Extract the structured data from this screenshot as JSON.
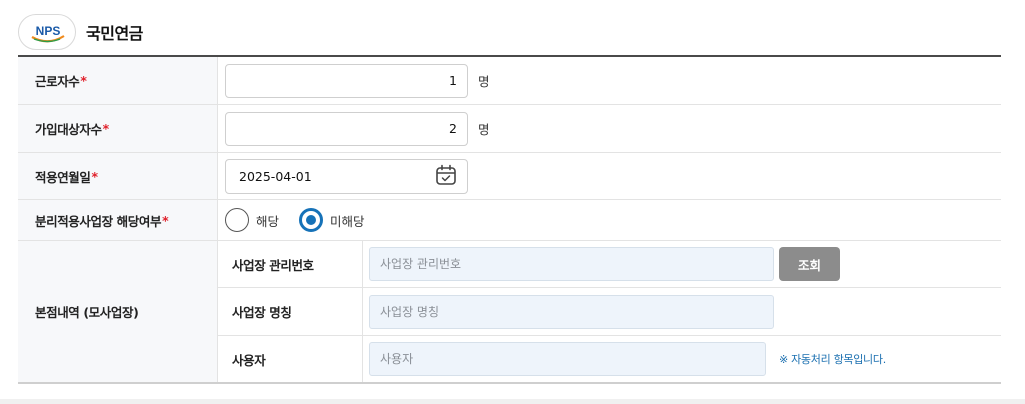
{
  "header": {
    "logo_text": "NPS",
    "title": "국민연금"
  },
  "form": {
    "workers": {
      "label": "근로자수",
      "required_mark": "*",
      "value": "1",
      "unit": "명"
    },
    "enrollees": {
      "label": "가입대상자수",
      "required_mark": "*",
      "value": "2",
      "unit": "명"
    },
    "apply_date": {
      "label": "적용연월일",
      "required_mark": "*",
      "value": "2025-04-01",
      "icon": "calendar-icon"
    },
    "separate_site": {
      "label": "분리적용사업장 해당여부",
      "required_mark": "*",
      "options": [
        {
          "label": "해당",
          "checked": false
        },
        {
          "label": "미해당",
          "checked": true
        }
      ]
    },
    "head_office": {
      "label": "본점내역 (모사업장)",
      "fields": {
        "mgmt_no": {
          "label": "사업장 관리번호",
          "placeholder": "사업장 관리번호",
          "button": "조회"
        },
        "site_name": {
          "label": "사업장 명칭",
          "placeholder": "사업장 명칭"
        },
        "user": {
          "label": "사용자",
          "placeholder": "사용자",
          "note": "※ 자동처리 항목입니다."
        }
      }
    }
  },
  "colors": {
    "accent": "#1672b8",
    "required": "#e0202a",
    "input_bg": "#eef4fb",
    "button_bg": "#8c8c8c",
    "logo_arc_orange": "#f08a1c",
    "logo_arc_green": "#2a9d4a"
  }
}
